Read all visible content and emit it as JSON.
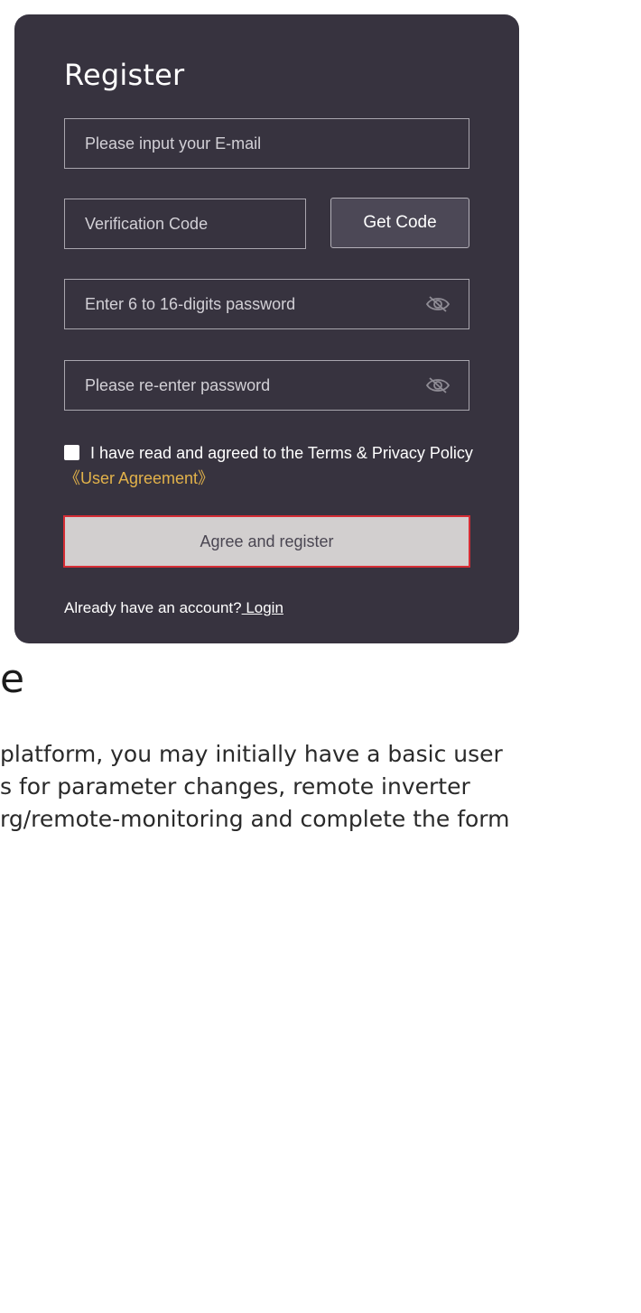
{
  "register_form": {
    "title": "Register",
    "email_placeholder": "Please input your E-mail",
    "code_placeholder": "Verification Code",
    "get_code_label": "Get Code",
    "password_placeholder": "Enter 6 to 16-digits password",
    "password_confirm_placeholder": "Please re-enter password",
    "agree_text": "I have read and agreed to the Terms & Privacy Policy",
    "agreement_link": "《User Agreement》",
    "register_button": "Agree and register",
    "already_text": "Already have an account?",
    "login_link": " Login",
    "checkbox_checked": false,
    "password_icon": "eye-slash-icon"
  },
  "article": {
    "heading_fragment": "e",
    "lines": [
      "platform, you may initially have a basic user",
      "s for parameter changes, remote inverter",
      "rg/remote-monitoring and complete the form"
    ]
  },
  "colors": {
    "card_background": "#37333f",
    "accent_link": "#e2b24a",
    "register_button_border": "#d52d35",
    "register_button_fill": "#d2cfcf"
  }
}
